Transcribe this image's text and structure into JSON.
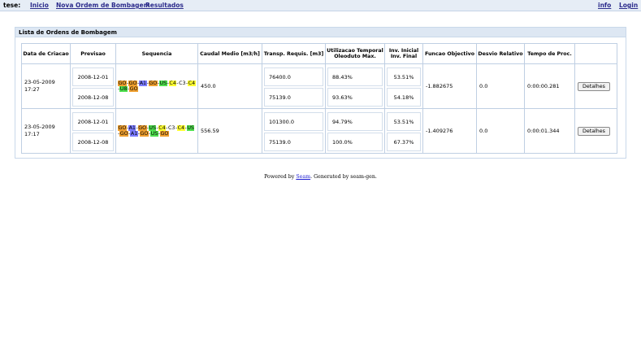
{
  "nav": {
    "brand": "tese:",
    "links": [
      "Inicio",
      "Nova Ordem de Bombagem",
      "Resultados"
    ],
    "right": [
      "info",
      "Login"
    ]
  },
  "panel": {
    "title": "Lista de Ordens de Bombagem",
    "headers": [
      "Data de Criacao",
      "Previsao",
      "Sequencia",
      "Caudal Medio [m3/h]",
      "Transp. Requis. [m3]",
      "Utilizacao Temporal Oleoduto Max.",
      "Inv. Inicial Inv. Final",
      "Funcao Objectivo",
      "Desvio Relativo",
      "Tempo de Proc.",
      ""
    ],
    "rows": [
      {
        "created_date": "23-05-2009",
        "created_time": "17:27",
        "forecast": [
          "2008-12-01",
          "2008-12-08"
        ],
        "sequence": [
          {
            "t": "GO",
            "c": "orange"
          },
          {
            "t": "-",
            "c": ""
          },
          {
            "t": "GO",
            "c": "orange"
          },
          {
            "t": "-",
            "c": ""
          },
          {
            "t": "A1",
            "c": "blue"
          },
          {
            "t": "-",
            "c": ""
          },
          {
            "t": "GO",
            "c": "orange"
          },
          {
            "t": "-",
            "c": ""
          },
          {
            "t": "US",
            "c": "green"
          },
          {
            "t": "-",
            "c": ""
          },
          {
            "t": "C4",
            "c": "yellow"
          },
          {
            "t": "-",
            "c": ""
          },
          {
            "t": "C3",
            "c": ""
          },
          {
            "t": "-",
            "c": ""
          },
          {
            "t": "C4",
            "c": "yellow"
          },
          {
            "t": "-",
            "c": ""
          },
          {
            "t": "U8",
            "c": "green"
          },
          {
            "t": "-",
            "c": ""
          },
          {
            "t": "GO",
            "c": "orange"
          }
        ],
        "flow": "450.0",
        "transp": [
          "76400.0",
          "75139.0"
        ],
        "util": [
          "88.43%",
          "93.63%"
        ],
        "inv": [
          "53.51%",
          "54.18%"
        ],
        "objective": "-1.882675",
        "deviation": "0.0",
        "proc_time": "0:00:00.281",
        "button": "Detalhes"
      },
      {
        "created_date": "23-05-2009",
        "created_time": "17:17",
        "forecast": [
          "2008-12-01",
          "2008-12-08"
        ],
        "sequence": [
          {
            "t": "GO",
            "c": "orange"
          },
          {
            "t": "-",
            "c": ""
          },
          {
            "t": "A1",
            "c": "blue"
          },
          {
            "t": "-",
            "c": ""
          },
          {
            "t": "GO",
            "c": "orange"
          },
          {
            "t": "-",
            "c": ""
          },
          {
            "t": "US",
            "c": "green"
          },
          {
            "t": "-",
            "c": ""
          },
          {
            "t": "C4",
            "c": "yellow"
          },
          {
            "t": "-",
            "c": ""
          },
          {
            "t": "C3",
            "c": ""
          },
          {
            "t": "-",
            "c": ""
          },
          {
            "t": "C4",
            "c": "yellow"
          },
          {
            "t": "-",
            "c": ""
          },
          {
            "t": "US",
            "c": "green"
          },
          {
            "t": "-",
            "c": ""
          },
          {
            "t": "GO",
            "c": "orange"
          },
          {
            "t": "-",
            "c": ""
          },
          {
            "t": "A1",
            "c": "blue"
          },
          {
            "t": "-",
            "c": ""
          },
          {
            "t": "GO",
            "c": "orange"
          },
          {
            "t": "-",
            "c": ""
          },
          {
            "t": "US",
            "c": "green"
          },
          {
            "t": "-",
            "c": ""
          },
          {
            "t": "GO",
            "c": "orange"
          }
        ],
        "flow": "556.59",
        "transp": [
          "101300.0",
          "75139.0"
        ],
        "util": [
          "94.79%",
          "100.0%"
        ],
        "inv": [
          "53.51%",
          "67.37%"
        ],
        "objective": "-1.409276",
        "deviation": "0.0",
        "proc_time": "0:00:01.344",
        "button": "Detalhes"
      }
    ]
  },
  "footer": {
    "prefix": "Powered by ",
    "link": "Seam",
    "suffix": ". Generated by seam-gen."
  },
  "colors": {
    "orange": "#f0a030",
    "blue": "#7b7bff",
    "green": "#4fe04f",
    "yellow": "#ffff33",
    "header_bg": "#dde7f3",
    "border": "#bfcfe3"
  }
}
